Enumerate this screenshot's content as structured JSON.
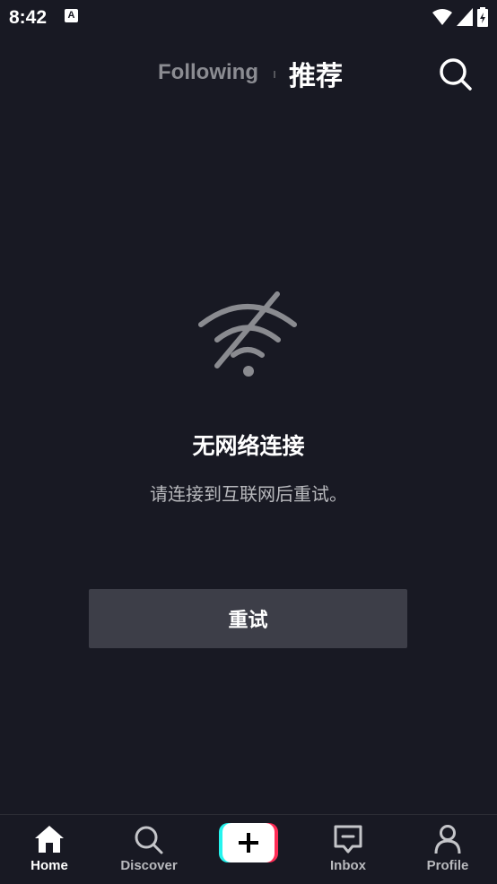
{
  "status_bar": {
    "time": "8:42",
    "app_icon_letter": "A"
  },
  "top_nav": {
    "following": "Following",
    "recommend": "推荐"
  },
  "empty_state": {
    "icon": "wifi-off-icon",
    "title": "无网络连接",
    "subtitle": "请连接到互联网后重试。",
    "retry": "重试"
  },
  "bottom_nav": {
    "items": [
      {
        "label": "Home",
        "icon": "home-icon",
        "active": true
      },
      {
        "label": "Discover",
        "icon": "search-icon",
        "active": false
      },
      {
        "label": "",
        "icon": "create-plus-icon",
        "active": false
      },
      {
        "label": "Inbox",
        "icon": "inbox-icon",
        "active": false
      },
      {
        "label": "Profile",
        "icon": "profile-icon",
        "active": false
      }
    ]
  },
  "colors": {
    "background": "#181923",
    "button": "#3d3e48",
    "accent_cyan": "#25f4ee",
    "accent_pink": "#fe2c55"
  }
}
